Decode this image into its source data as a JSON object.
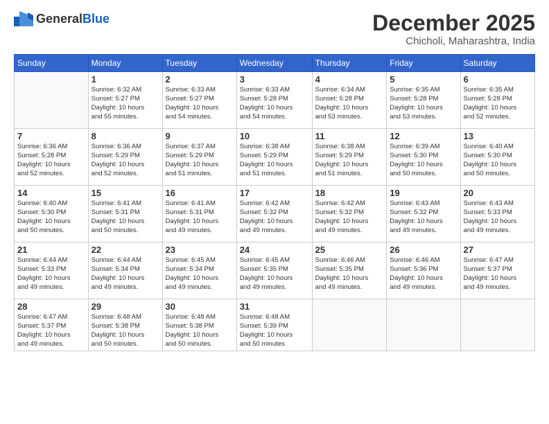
{
  "header": {
    "logo_general": "General",
    "logo_blue": "Blue",
    "month": "December 2025",
    "location": "Chicholi, Maharashtra, India"
  },
  "weekdays": [
    "Sunday",
    "Monday",
    "Tuesday",
    "Wednesday",
    "Thursday",
    "Friday",
    "Saturday"
  ],
  "weeks": [
    [
      {
        "day": "",
        "text": ""
      },
      {
        "day": "1",
        "text": "Sunrise: 6:32 AM\nSunset: 5:27 PM\nDaylight: 10 hours\nand 55 minutes."
      },
      {
        "day": "2",
        "text": "Sunrise: 6:33 AM\nSunset: 5:27 PM\nDaylight: 10 hours\nand 54 minutes."
      },
      {
        "day": "3",
        "text": "Sunrise: 6:33 AM\nSunset: 5:28 PM\nDaylight: 10 hours\nand 54 minutes."
      },
      {
        "day": "4",
        "text": "Sunrise: 6:34 AM\nSunset: 5:28 PM\nDaylight: 10 hours\nand 53 minutes."
      },
      {
        "day": "5",
        "text": "Sunrise: 6:35 AM\nSunset: 5:28 PM\nDaylight: 10 hours\nand 53 minutes."
      },
      {
        "day": "6",
        "text": "Sunrise: 6:35 AM\nSunset: 5:28 PM\nDaylight: 10 hours\nand 52 minutes."
      }
    ],
    [
      {
        "day": "7",
        "text": "Sunrise: 6:36 AM\nSunset: 5:28 PM\nDaylight: 10 hours\nand 52 minutes."
      },
      {
        "day": "8",
        "text": "Sunrise: 6:36 AM\nSunset: 5:29 PM\nDaylight: 10 hours\nand 52 minutes."
      },
      {
        "day": "9",
        "text": "Sunrise: 6:37 AM\nSunset: 5:29 PM\nDaylight: 10 hours\nand 51 minutes."
      },
      {
        "day": "10",
        "text": "Sunrise: 6:38 AM\nSunset: 5:29 PM\nDaylight: 10 hours\nand 51 minutes."
      },
      {
        "day": "11",
        "text": "Sunrise: 6:38 AM\nSunset: 5:29 PM\nDaylight: 10 hours\nand 51 minutes."
      },
      {
        "day": "12",
        "text": "Sunrise: 6:39 AM\nSunset: 5:30 PM\nDaylight: 10 hours\nand 50 minutes."
      },
      {
        "day": "13",
        "text": "Sunrise: 6:40 AM\nSunset: 5:30 PM\nDaylight: 10 hours\nand 50 minutes."
      }
    ],
    [
      {
        "day": "14",
        "text": "Sunrise: 6:40 AM\nSunset: 5:30 PM\nDaylight: 10 hours\nand 50 minutes."
      },
      {
        "day": "15",
        "text": "Sunrise: 6:41 AM\nSunset: 5:31 PM\nDaylight: 10 hours\nand 50 minutes."
      },
      {
        "day": "16",
        "text": "Sunrise: 6:41 AM\nSunset: 5:31 PM\nDaylight: 10 hours\nand 49 minutes."
      },
      {
        "day": "17",
        "text": "Sunrise: 6:42 AM\nSunset: 5:32 PM\nDaylight: 10 hours\nand 49 minutes."
      },
      {
        "day": "18",
        "text": "Sunrise: 6:42 AM\nSunset: 5:32 PM\nDaylight: 10 hours\nand 49 minutes."
      },
      {
        "day": "19",
        "text": "Sunrise: 6:43 AM\nSunset: 5:32 PM\nDaylight: 10 hours\nand 49 minutes."
      },
      {
        "day": "20",
        "text": "Sunrise: 6:43 AM\nSunset: 5:33 PM\nDaylight: 10 hours\nand 49 minutes."
      }
    ],
    [
      {
        "day": "21",
        "text": "Sunrise: 6:44 AM\nSunset: 5:33 PM\nDaylight: 10 hours\nand 49 minutes."
      },
      {
        "day": "22",
        "text": "Sunrise: 6:44 AM\nSunset: 5:34 PM\nDaylight: 10 hours\nand 49 minutes."
      },
      {
        "day": "23",
        "text": "Sunrise: 6:45 AM\nSunset: 5:34 PM\nDaylight: 10 hours\nand 49 minutes."
      },
      {
        "day": "24",
        "text": "Sunrise: 6:45 AM\nSunset: 5:35 PM\nDaylight: 10 hours\nand 49 minutes."
      },
      {
        "day": "25",
        "text": "Sunrise: 6:46 AM\nSunset: 5:35 PM\nDaylight: 10 hours\nand 49 minutes."
      },
      {
        "day": "26",
        "text": "Sunrise: 6:46 AM\nSunset: 5:36 PM\nDaylight: 10 hours\nand 49 minutes."
      },
      {
        "day": "27",
        "text": "Sunrise: 6:47 AM\nSunset: 5:37 PM\nDaylight: 10 hours\nand 49 minutes."
      }
    ],
    [
      {
        "day": "28",
        "text": "Sunrise: 6:47 AM\nSunset: 5:37 PM\nDaylight: 10 hours\nand 49 minutes."
      },
      {
        "day": "29",
        "text": "Sunrise: 6:48 AM\nSunset: 5:38 PM\nDaylight: 10 hours\nand 50 minutes."
      },
      {
        "day": "30",
        "text": "Sunrise: 6:48 AM\nSunset: 5:38 PM\nDaylight: 10 hours\nand 50 minutes."
      },
      {
        "day": "31",
        "text": "Sunrise: 6:48 AM\nSunset: 5:39 PM\nDaylight: 10 hours\nand 50 minutes."
      },
      {
        "day": "",
        "text": ""
      },
      {
        "day": "",
        "text": ""
      },
      {
        "day": "",
        "text": ""
      }
    ]
  ]
}
